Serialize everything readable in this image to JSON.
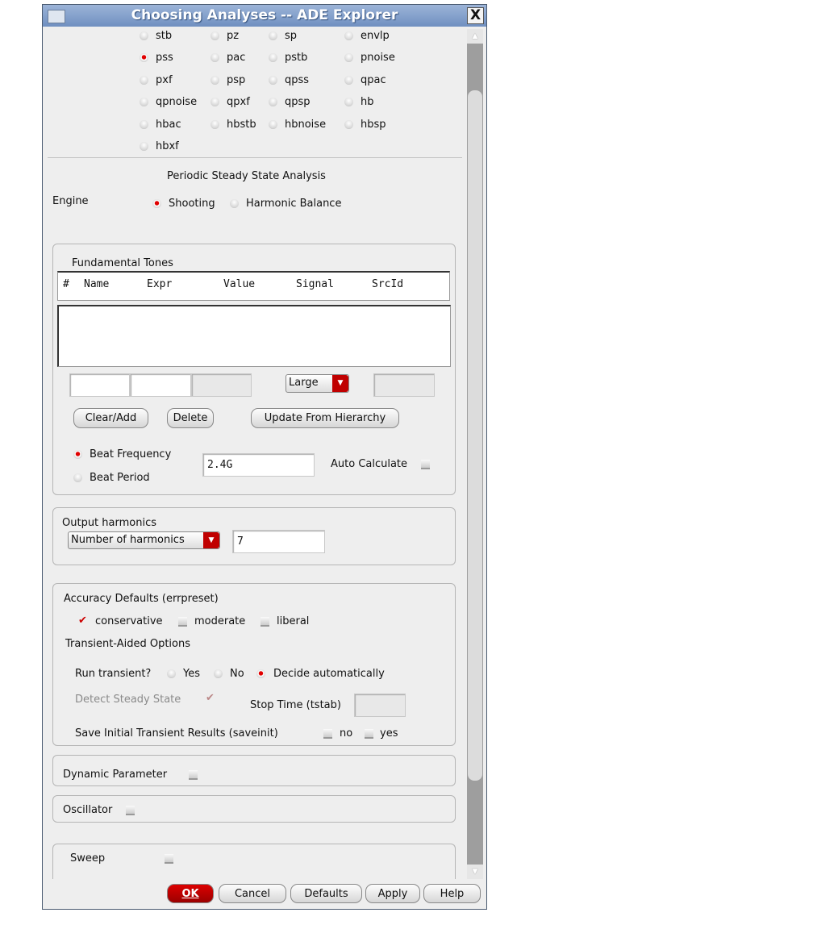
{
  "window": {
    "title": "Choosing Analyses -- ADE Explorer",
    "close": "X"
  },
  "analyses": [
    [
      "stb",
      "pz",
      "sp",
      "envlp"
    ],
    [
      "pss",
      "pac",
      "pstb",
      "pnoise"
    ],
    [
      "pxf",
      "psp",
      "qpss",
      "qpac"
    ],
    [
      "qpnoise",
      "qpxf",
      "qpsp",
      "hb"
    ],
    [
      "hbac",
      "hbstb",
      "hbnoise",
      "hbsp"
    ],
    [
      "hbxf"
    ]
  ],
  "selected_analysis": "pss",
  "pss": {
    "heading": "Periodic Steady State Analysis",
    "engine_label": "Engine",
    "engine_options": [
      "Shooting",
      "Harmonic Balance"
    ],
    "engine_selected": "Shooting",
    "fundamental": {
      "title": "Fundamental Tones",
      "columns": [
        "#",
        "Name",
        "Expr",
        "Value",
        "Signal",
        "SrcId"
      ],
      "rows": [],
      "size_select": "Large",
      "buttons": {
        "clear_add": "Clear/Add",
        "delete": "Delete",
        "update": "Update From Hierarchy"
      },
      "beat_frequency": "Beat Frequency",
      "beat_period": "Beat Period",
      "beat_value": "2.4G",
      "auto_calculate": "Auto Calculate"
    },
    "harmonics": {
      "title": "Output harmonics",
      "select": "Number of harmonics",
      "value": "7"
    },
    "accuracy": {
      "title": "Accuracy Defaults (errpreset)",
      "options": [
        "conservative",
        "moderate",
        "liberal"
      ],
      "checked": "conservative",
      "transient_title": "Transient-Aided Options",
      "run_transient": "Run transient?",
      "run_options": [
        "Yes",
        "No",
        "Decide automatically"
      ],
      "run_selected": "Decide automatically",
      "detect_steady": "Detect Steady State",
      "stop_time": "Stop Time (tstab)",
      "save_init": "Save Initial Transient Results (saveinit)",
      "save_no": "no",
      "save_yes": "yes"
    },
    "dynamic_parameter": "Dynamic Parameter",
    "oscillator": "Oscillator",
    "sweep": "Sweep"
  },
  "footer": {
    "ok": "OK",
    "cancel": "Cancel",
    "defaults": "Defaults",
    "apply": "Apply",
    "help": "Help"
  }
}
